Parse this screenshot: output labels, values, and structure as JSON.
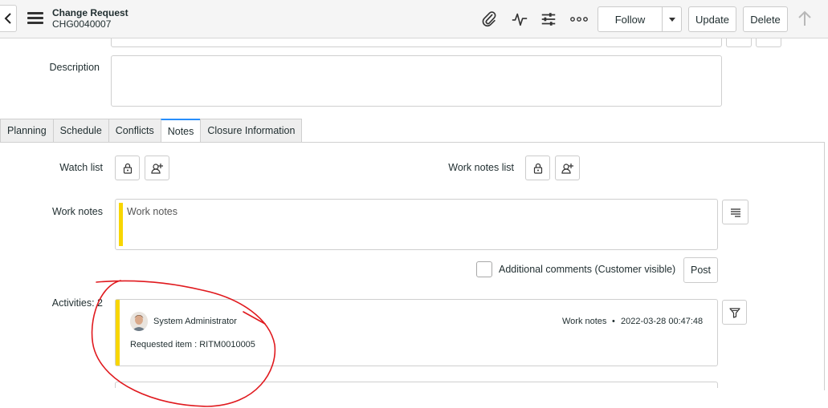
{
  "header": {
    "title": "Change Request",
    "number": "CHG0040007",
    "follow_label": "Follow",
    "update_label": "Update",
    "delete_label": "Delete"
  },
  "form": {
    "description_label": "Description"
  },
  "tabs": [
    {
      "label": "Planning"
    },
    {
      "label": "Schedule"
    },
    {
      "label": "Conflicts"
    },
    {
      "label": "Notes"
    },
    {
      "label": "Closure Information"
    }
  ],
  "notes": {
    "watch_list_label": "Watch list",
    "work_notes_list_label": "Work notes list",
    "work_notes_label": "Work notes",
    "work_notes_placeholder": "Work notes",
    "additional_comments_label": "Additional comments (Customer visible)",
    "post_label": "Post",
    "activities_label": "Activities: 2"
  },
  "activity": {
    "author": "System Administrator",
    "type": "Work notes",
    "separator": "•",
    "timestamp": "2022-03-28 00:47:48",
    "content": "Requested item : RITM0010005"
  },
  "colors": {
    "accent": "#278efc",
    "work_notes_bar": "#f8d600",
    "annotation": "#e0191e"
  }
}
